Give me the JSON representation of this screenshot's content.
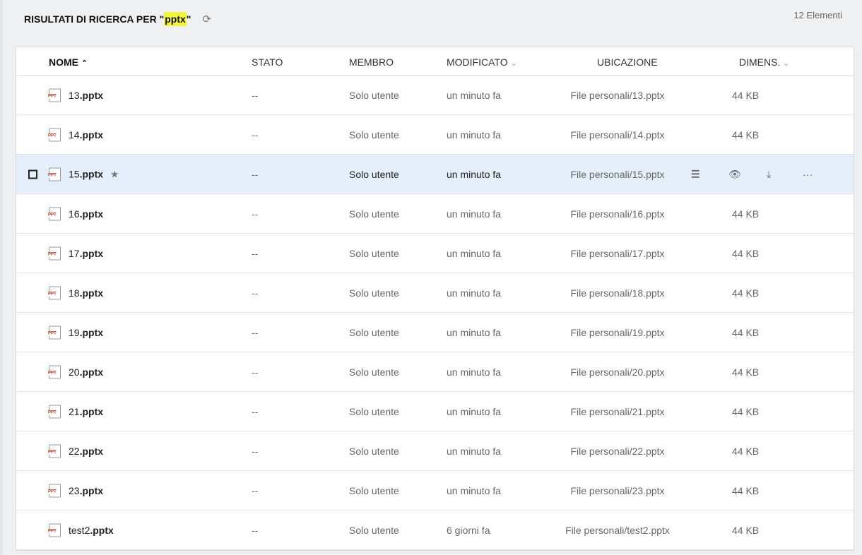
{
  "header": {
    "title_prefix": "RISULTATI DI RICERCA PER \"",
    "query": "pptx",
    "title_suffix": "\"",
    "count": "12 Elementi"
  },
  "columns": {
    "name": "NOME",
    "status": "STATO",
    "member": "MEMBRO",
    "modified": "MODIFICATO",
    "location": "UBICAZIONE",
    "size": "DIMENS."
  },
  "file_icon_label": "PPT",
  "rows": [
    {
      "base": "13",
      "ext": ".pptx",
      "status": "--",
      "member": "Solo utente",
      "modified": "un minuto fa",
      "location": "File personali/13.pptx",
      "size": "44 KB"
    },
    {
      "base": "14",
      "ext": ".pptx",
      "status": "--",
      "member": "Solo utente",
      "modified": "un minuto fa",
      "location": "File personali/14.pptx",
      "size": "44 KB"
    },
    {
      "base": "15",
      "ext": ".pptx",
      "status": "--",
      "member": "Solo utente",
      "modified": "un minuto fa",
      "location": "File personali/15.pptx",
      "size": "44 KB"
    },
    {
      "base": "16",
      "ext": ".pptx",
      "status": "--",
      "member": "Solo utente",
      "modified": "un minuto fa",
      "location": "File personali/16.pptx",
      "size": "44 KB"
    },
    {
      "base": "17",
      "ext": ".pptx",
      "status": "--",
      "member": "Solo utente",
      "modified": "un minuto fa",
      "location": "File personali/17.pptx",
      "size": "44 KB"
    },
    {
      "base": "18",
      "ext": ".pptx",
      "status": "--",
      "member": "Solo utente",
      "modified": "un minuto fa",
      "location": "File personali/18.pptx",
      "size": "44 KB"
    },
    {
      "base": "19",
      "ext": ".pptx",
      "status": "--",
      "member": "Solo utente",
      "modified": "un minuto fa",
      "location": "File personali/19.pptx",
      "size": "44 KB"
    },
    {
      "base": "20",
      "ext": ".pptx",
      "status": "--",
      "member": "Solo utente",
      "modified": "un minuto fa",
      "location": "File personali/20.pptx",
      "size": "44 KB"
    },
    {
      "base": "21",
      "ext": ".pptx",
      "status": "--",
      "member": "Solo utente",
      "modified": "un minuto fa",
      "location": "File personali/21.pptx",
      "size": "44 KB"
    },
    {
      "base": "22",
      "ext": ".pptx",
      "status": "--",
      "member": "Solo utente",
      "modified": "un minuto fa",
      "location": "File personali/22.pptx",
      "size": "44 KB"
    },
    {
      "base": "23",
      "ext": ".pptx",
      "status": "--",
      "member": "Solo utente",
      "modified": "un minuto fa",
      "location": "File personali/23.pptx",
      "size": "44 KB"
    },
    {
      "base": "test2",
      "ext": ".pptx",
      "status": "--",
      "member": "Solo utente",
      "modified": "6 giorni fa",
      "location": "File personali/test2.pptx",
      "size": "44 KB"
    }
  ],
  "selected_row": 2
}
